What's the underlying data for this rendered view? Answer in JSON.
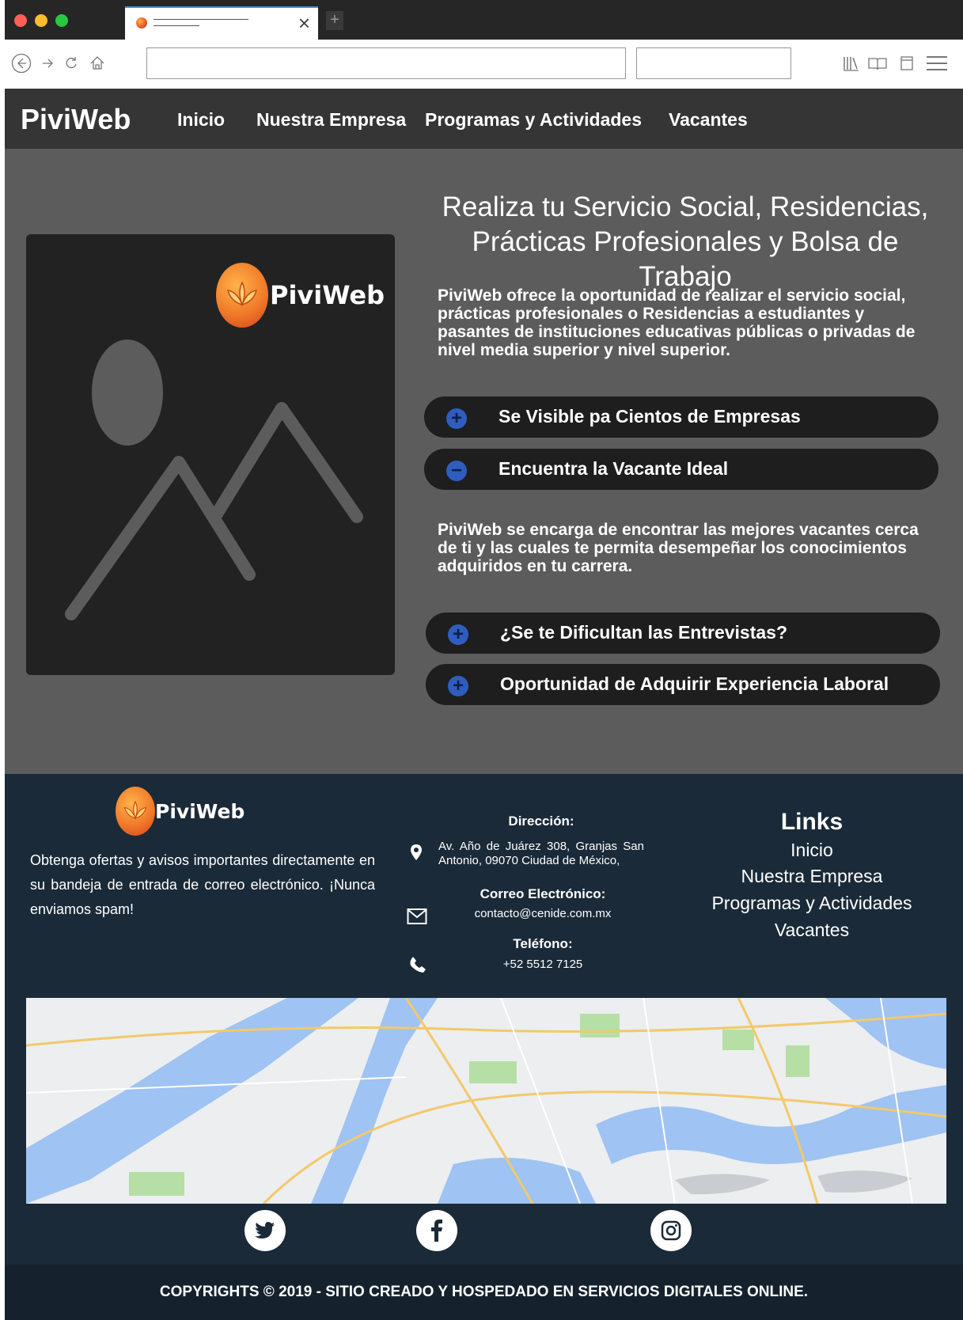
{
  "browser": {
    "tab_title": "",
    "url": "",
    "search": ""
  },
  "site": {
    "brand": "PiviWeb",
    "menu": [
      "Inicio",
      "Nuestra Empresa",
      "Programas y Actividades",
      "Vacantes"
    ]
  },
  "hero": {
    "logo_text": "PiviWeb",
    "title_line1": "Realiza tu Servicio Social, Residencias,",
    "title_line2": "Prácticas Profesionales y Bolsa de Trabajo",
    "intro": "PiviWeb ofrece la oportunidad de realizar el servicio social, prácticas profesionales o  Residencias a  estudiantes y pasantes de instituciones educativas públicas o privadas de nivel media superior y nivel superior.",
    "accordion": [
      {
        "label": "Se Visible pa Cientos de Empresas",
        "icon": "+"
      },
      {
        "label": "Encuentra la Vacante Ideal",
        "icon": "−"
      },
      {
        "label": "¿Se te Dificultan las Entrevistas?",
        "icon": "+"
      },
      {
        "label": "Oportunidad de Adquirir Experiencia Laboral",
        "icon": "+"
      }
    ],
    "expanded_text": "PiviWeb se encarga de encontrar las mejores vacantes cerca de ti y las cuales te permita desempeñar los conocimientos adquiridos en tu carrera."
  },
  "footer": {
    "logo_text": "PiviWeb",
    "newsletter": "Obtenga ofertas y avisos importantes directamente en su bandeja de entrada de correo electrónico. ¡Nunca enviamos spam!",
    "address_label": "Dirección:",
    "address": "Av. Año de Juárez 308, Granjas San Antonio, 09070 Ciudad de México,",
    "email_label": "Correo Electrónico:",
    "email": "contacto@cenide.com.mx",
    "phone_label": "Teléfono:",
    "phone": "+52 5512 7125",
    "links_title": "Links",
    "links": [
      "Inicio",
      "Nuestra Empresa",
      "Programas y Actividades",
      "Vacantes"
    ],
    "copyright": "COPYRIGHTS © 2019 - SITIO CREADO Y HOSPEDADO EN SERVICIOS DIGITALES ONLINE."
  },
  "colors": {
    "header": "#353535",
    "hero": "#5c5c5c",
    "footer": "#1a2a38",
    "accordion_icon": "#2f5dbf"
  },
  "icons": [
    "back-icon",
    "forward-icon",
    "reload-icon",
    "home-icon",
    "library-icon",
    "reader-icon",
    "sidebar-icon",
    "menu-icon",
    "map-pin-icon",
    "envelope-icon",
    "phone-icon",
    "twitter-icon",
    "facebook-icon",
    "instagram-icon"
  ]
}
